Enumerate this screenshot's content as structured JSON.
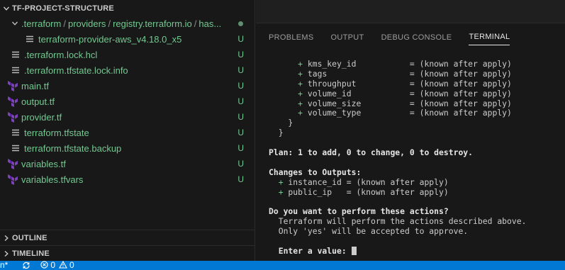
{
  "explorer": {
    "project_title": "TF-PROJECT-STRUCTURE",
    "compact_folder": {
      "segments": [
        ".terraform",
        "providers",
        "registry.terraform.io",
        "has..."
      ],
      "separator": "/"
    },
    "items": [
      {
        "name": "terraform-provider-aws_v4.18.0_x5",
        "status": "U",
        "icon": "file-lines-icon"
      },
      {
        "name": ".terraform.lock.hcl",
        "status": "U",
        "icon": "file-lines-icon"
      },
      {
        "name": ".terraform.tfstate.lock.info",
        "status": "U",
        "icon": "file-lines-icon"
      },
      {
        "name": "main.tf",
        "status": "U",
        "icon": "terraform-icon"
      },
      {
        "name": "output.tf",
        "status": "U",
        "icon": "terraform-icon"
      },
      {
        "name": "provider.tf",
        "status": "U",
        "icon": "terraform-icon"
      },
      {
        "name": "terraform.tfstate",
        "status": "U",
        "icon": "file-lines-icon"
      },
      {
        "name": "terraform.tfstate.backup",
        "status": "U",
        "icon": "file-lines-icon"
      },
      {
        "name": "variables.tf",
        "status": "U",
        "icon": "terraform-icon"
      },
      {
        "name": "variables.tfvars",
        "status": "U",
        "icon": "terraform-icon"
      }
    ],
    "outline_label": "OUTLINE",
    "timeline_label": "TIMELINE"
  },
  "panel": {
    "tabs": [
      "PROBLEMS",
      "OUTPUT",
      "DEBUG CONSOLE",
      "TERMINAL"
    ],
    "active_tab": "TERMINAL"
  },
  "terminal": {
    "lines": [
      "      + kms_key_id           = (known after apply)",
      "      + tags                 = (known after apply)",
      "      + throughput           = (known after apply)",
      "      + volume_id            = (known after apply)",
      "      + volume_size          = (known after apply)",
      "      + volume_type          = (known after apply)",
      "    }",
      "  }",
      "",
      "Plan: 1 to add, 0 to change, 0 to destroy.",
      "",
      "Changes to Outputs:",
      "  + instance_id = (known after apply)",
      "  + public_ip   = (known after apply)",
      "",
      "Do you want to perform these actions?",
      "  Terraform will perform the actions described above.",
      "  Only 'yes' will be accepted to approve.",
      "",
      "  Enter a value: "
    ]
  },
  "statusbar": {
    "branch_fragment": "n*",
    "errors": "0",
    "warnings": "0"
  },
  "colors": {
    "untracked_green": "#73c991",
    "statusbar_blue": "#0078d4",
    "terraform_purple": "#7b42bc"
  }
}
